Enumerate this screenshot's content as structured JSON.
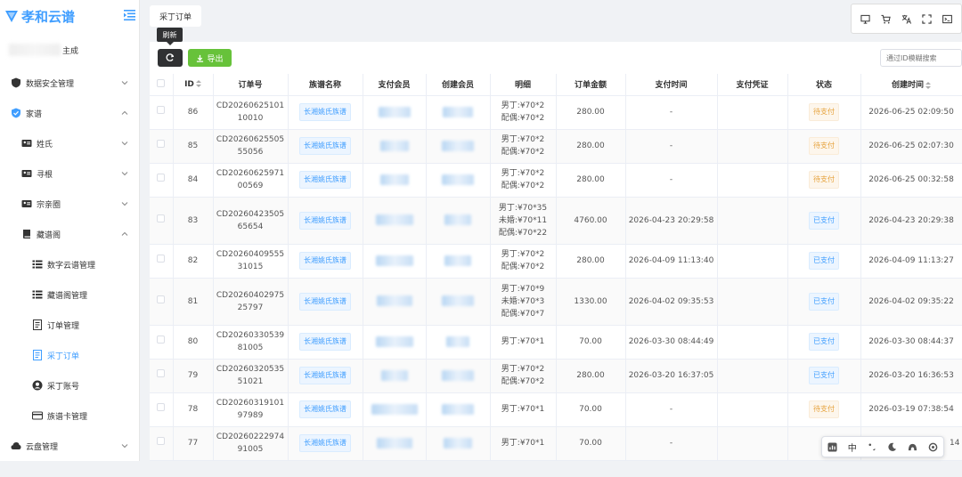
{
  "app": {
    "title": "孝和云谱",
    "user_suffix": "主成"
  },
  "sidebar": {
    "items": [
      {
        "label": "数据安全管理",
        "icon": "shield-icon",
        "level": 1,
        "arrow": "down"
      },
      {
        "label": "家谱",
        "icon": "shield-check-icon",
        "level": 1,
        "arrow": "up"
      },
      {
        "label": "姓氏",
        "icon": "id-card-icon",
        "level": 2,
        "arrow": "down"
      },
      {
        "label": "寻根",
        "icon": "id-card-icon",
        "level": 2,
        "arrow": "down"
      },
      {
        "label": "宗亲圈",
        "icon": "id-card-icon",
        "level": 2,
        "arrow": "down"
      },
      {
        "label": "藏谱阁",
        "icon": "book-icon",
        "level": 2,
        "arrow": "up"
      },
      {
        "label": "数字云谱管理",
        "icon": "list-icon",
        "level": 3
      },
      {
        "label": "藏谱阁管理",
        "icon": "list-icon",
        "level": 3
      },
      {
        "label": "订单管理",
        "icon": "document-icon",
        "level": 3
      },
      {
        "label": "采丁订单",
        "icon": "document-icon",
        "level": 3,
        "active": true
      },
      {
        "label": "采丁账号",
        "icon": "user-circle-icon",
        "level": 3
      },
      {
        "label": "族谱卡管理",
        "icon": "card-icon",
        "level": 3
      },
      {
        "label": "云盘管理",
        "icon": "cloud-icon",
        "level": 1,
        "arrow": "down"
      }
    ]
  },
  "tabs": {
    "active": "采丁订单"
  },
  "toolbar": {
    "refresh_tooltip": "刷新",
    "export_label": "导出",
    "search_placeholder": "通过ID模糊搜索"
  },
  "table": {
    "columns": [
      "ID",
      "订单号",
      "族谱名称",
      "支付会员",
      "创建会员",
      "明细",
      "订单金额",
      "支付时间",
      "支付凭证",
      "状态",
      "创建时间"
    ],
    "rows": [
      {
        "id": "86",
        "order_no": [
          "CD20260625101",
          "10010"
        ],
        "genealogy": "长湘姚氏族谱",
        "detail": [
          "男丁:¥70*2",
          "配偶:¥70*2"
        ],
        "amount": "280.00",
        "pay_time": "-",
        "status": "待支付",
        "status_type": "pending",
        "created": "2026-06-25 02:09:50"
      },
      {
        "id": "85",
        "order_no": [
          "CD20260625505",
          "55056"
        ],
        "genealogy": "长湘姚氏族谱",
        "detail": [
          "男丁:¥70*2",
          "配偶:¥70*2"
        ],
        "amount": "280.00",
        "pay_time": "-",
        "status": "待支付",
        "status_type": "pending",
        "created": "2026-06-25 02:07:30"
      },
      {
        "id": "84",
        "order_no": [
          "CD20260625971",
          "00569"
        ],
        "genealogy": "长湘姚氏族谱",
        "detail": [
          "男丁:¥70*2",
          "配偶:¥70*2"
        ],
        "amount": "280.00",
        "pay_time": "-",
        "status": "待支付",
        "status_type": "pending",
        "created": "2026-06-25 00:32:58"
      },
      {
        "id": "83",
        "order_no": [
          "CD20260423505",
          "65654"
        ],
        "genealogy": "长湘姚氏族谱",
        "detail": [
          "男丁:¥70*35",
          "未婚:¥70*11",
          "配偶:¥70*22"
        ],
        "amount": "4760.00",
        "pay_time": "2026-04-23 20:29:58",
        "status": "已支付",
        "status_type": "paid",
        "created": "2026-04-23 20:29:38"
      },
      {
        "id": "82",
        "order_no": [
          "CD20260409555",
          "31015"
        ],
        "genealogy": "长湘姚氏族谱",
        "detail": [
          "男丁:¥70*2",
          "配偶:¥70*2"
        ],
        "amount": "280.00",
        "pay_time": "2026-04-09 11:13:40",
        "status": "已支付",
        "status_type": "paid",
        "created": "2026-04-09 11:13:27"
      },
      {
        "id": "81",
        "order_no": [
          "CD20260402975",
          "25797"
        ],
        "genealogy": "长湘姚氏族谱",
        "detail": [
          "男丁:¥70*9",
          "未婚:¥70*3",
          "配偶:¥70*7"
        ],
        "amount": "1330.00",
        "pay_time": "2026-04-02 09:35:53",
        "status": "已支付",
        "status_type": "paid",
        "created": "2026-04-02 09:35:22"
      },
      {
        "id": "80",
        "order_no": [
          "CD20260330539",
          "81005"
        ],
        "genealogy": "长湘姚氏族谱",
        "detail": [
          "男丁:¥70*1"
        ],
        "amount": "70.00",
        "pay_time": "2026-03-30 08:44:49",
        "status": "已支付",
        "status_type": "paid",
        "created": "2026-03-30 08:44:37"
      },
      {
        "id": "79",
        "order_no": [
          "CD20260320535",
          "51021"
        ],
        "genealogy": "长湘姚氏族谱",
        "detail": [
          "男丁:¥70*2",
          "配偶:¥70*2"
        ],
        "amount": "280.00",
        "pay_time": "2026-03-20 16:37:05",
        "status": "已支付",
        "status_type": "paid",
        "created": "2026-03-20 16:36:53"
      },
      {
        "id": "78",
        "order_no": [
          "CD20260319101",
          "97989"
        ],
        "genealogy": "长湘姚氏族谱",
        "detail": [
          "男丁:¥70*1"
        ],
        "amount": "70.00",
        "pay_time": "-",
        "status": "待支付",
        "status_type": "pending",
        "created": "2026-03-19 07:38:54"
      },
      {
        "id": "77",
        "order_no": [
          "CD20260222974",
          "91005"
        ],
        "genealogy": "长湘姚氏族谱",
        "detail": [
          "男丁:¥70*1"
        ],
        "amount": "70.00",
        "pay_time": "-",
        "status": "",
        "status_type": "",
        "created": "14"
      }
    ]
  },
  "float_toolbar": {
    "lang_label": "中"
  },
  "colors": {
    "primary": "#409eff",
    "success": "#67c23a",
    "warning": "#e6a23c",
    "dark": "#303133"
  }
}
